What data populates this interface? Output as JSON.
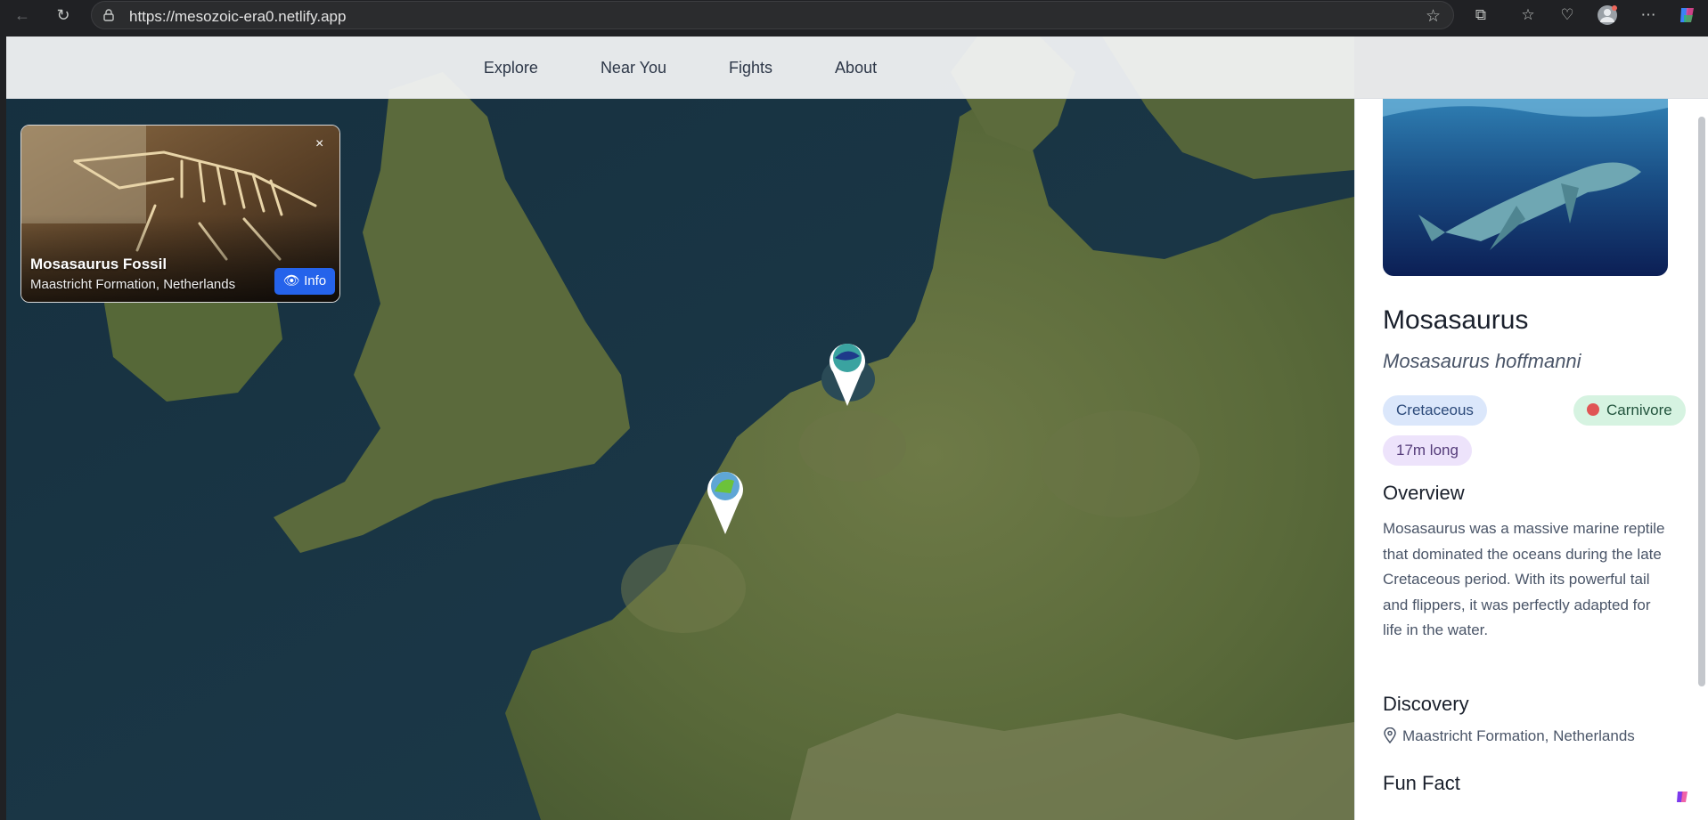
{
  "browser": {
    "url": "https://mesozoic-era0.netlify.app"
  },
  "nav": {
    "items": [
      {
        "label": "Explore"
      },
      {
        "label": "Near You"
      },
      {
        "label": "Fights"
      },
      {
        "label": "About"
      }
    ]
  },
  "popup": {
    "name": "Mosasaurus Fossil",
    "location": "Maastricht Formation, Netherlands",
    "info_label": "Info",
    "close_label": "×"
  },
  "panel": {
    "common_name": "Mosasaurus",
    "scientific_name": "Mosasaurus hoffmanni",
    "tags": {
      "period": "Cretaceous",
      "diet": "Carnivore",
      "length": "17m long"
    },
    "overview_heading": "Overview",
    "overview_text": "Mosasaurus was a massive marine reptile that dominated the oceans during the late Cretaceous period. With its powerful tail and flippers, it was perfectly adapted for life in the water.",
    "discovery_heading": "Discovery",
    "discovery_location": "Maastricht Formation, Netherlands",
    "funfact_heading": "Fun Fact"
  },
  "colors": {
    "accent": "#2563eb",
    "sea": "#1e3a4e",
    "land": "#5f6d3e"
  },
  "icons": {
    "back": "arrow-left-icon",
    "reload": "reload-icon",
    "lock": "lock-icon",
    "favorite": "star-icon",
    "extensions": "puzzle-icon",
    "favorites": "favorites-icon",
    "health": "heart-pulse-icon",
    "profile": "avatar-icon",
    "more": "more-icon",
    "copilot": "copilot-icon"
  }
}
